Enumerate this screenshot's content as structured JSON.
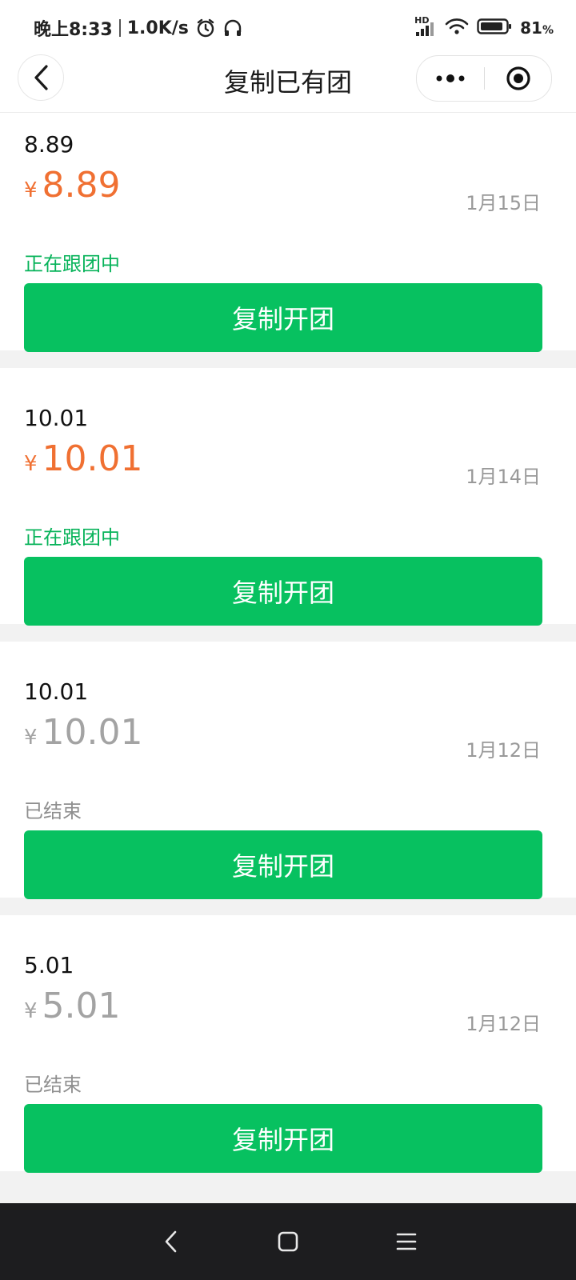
{
  "status_bar": {
    "time": "晚上8:33",
    "speed": "1.0K/s",
    "network": "HD",
    "battery": "81"
  },
  "nav": {
    "title": "复制已有团"
  },
  "cards": [
    {
      "name": "8.89",
      "currency": "¥",
      "price": "8.89",
      "date": "1月15日",
      "status": "正在跟团中",
      "button": "复制开团",
      "state": "active"
    },
    {
      "name": "10.01",
      "currency": "¥",
      "price": "10.01",
      "date": "1月14日",
      "status": "正在跟团中",
      "button": "复制开团",
      "state": "active"
    },
    {
      "name": "10.01",
      "currency": "¥",
      "price": "10.01",
      "date": "1月12日",
      "status": "已结束",
      "button": "复制开团",
      "state": "ended"
    },
    {
      "name": "5.01",
      "currency": "¥",
      "price": "5.01",
      "date": "1月12日",
      "status": "已结束",
      "button": "复制开团",
      "state": "ended"
    }
  ],
  "colors": {
    "accent_green": "#07c160",
    "price_active": "#f07032",
    "price_ended": "#a3a3a3",
    "status_active": "#07b35a"
  },
  "icons": {
    "back": "chevron-left-icon",
    "more": "more-dots-icon",
    "close": "target-close-icon",
    "sys_back": "sys-back-icon",
    "sys_home": "sys-home-icon",
    "sys_menu": "sys-menu-icon"
  }
}
